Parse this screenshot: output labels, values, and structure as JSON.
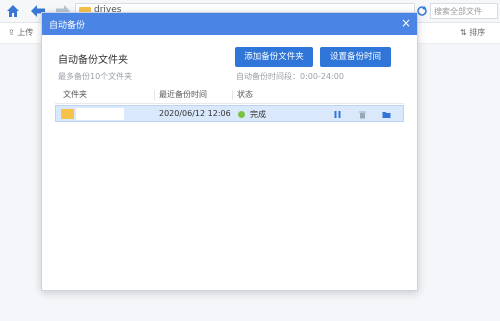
{
  "topbar": {
    "path": "drives",
    "search_placeholder": "搜索全部文件"
  },
  "subbar": {
    "upload": "上传",
    "sort": "排序"
  },
  "dialog": {
    "title": "自动备份",
    "close": "×",
    "section_title": "自动备份文件夹",
    "section_hint": "最多备份10个文件夹",
    "add_button": "添加备份文件夹",
    "time_button": "设置备份时间",
    "time_hint": "自动备份时间段：0:00-24:00",
    "columns": [
      "文件夹",
      "最近备份时间",
      "状态"
    ],
    "rows": [
      {
        "folder": "",
        "time": "2020/06/12 12:06",
        "status": "完成"
      }
    ]
  },
  "colors": {
    "accent": "#4a84e4",
    "button": "#2f76d8",
    "status_ok": "#7cc242",
    "row_selected": "#d9e8fb"
  }
}
